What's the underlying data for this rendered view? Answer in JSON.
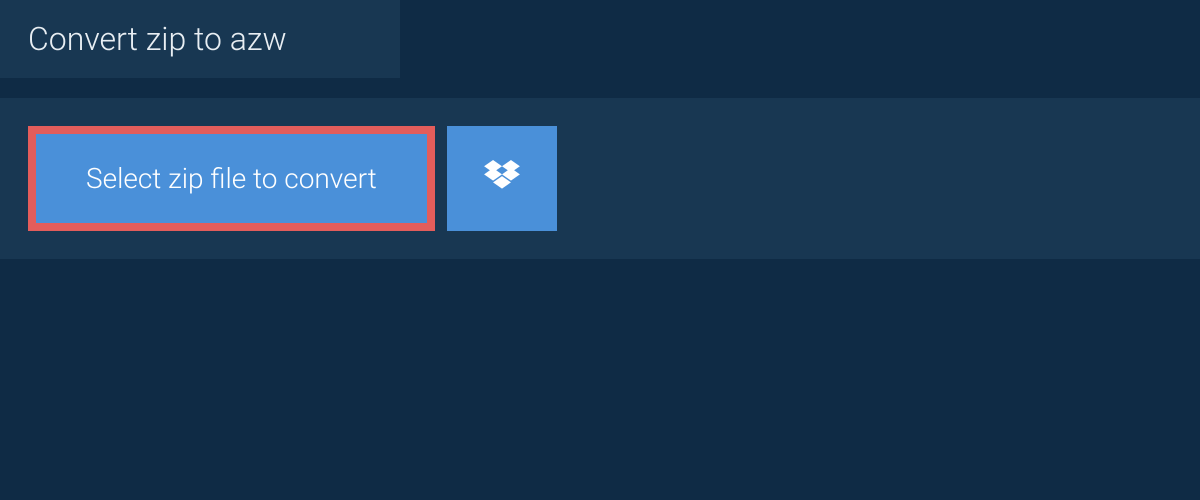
{
  "header": {
    "title": "Convert zip to azw"
  },
  "actions": {
    "select_file_label": "Select zip file to convert"
  }
}
